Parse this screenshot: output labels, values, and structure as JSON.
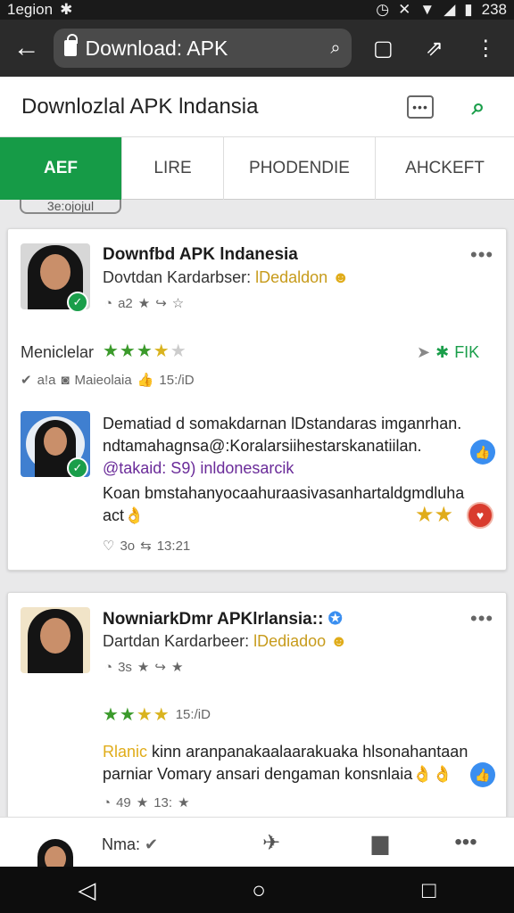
{
  "status": {
    "carrier": "1egion",
    "time": "238"
  },
  "browser": {
    "url": "Download: APK"
  },
  "header": {
    "title": "Downlozlal APK lndansia"
  },
  "tabs": [
    "AEF",
    "LIRE",
    "PHODENDIE",
    "AHCKEFT"
  ],
  "filter_chip": "3e:ojojul",
  "posts": [
    {
      "name": "Downfbd APK lndanesia",
      "subtitle_prefix": "Dovtdan Kardarbser:",
      "subtitle_highlight": "lDedaldon",
      "meta_count": "a2",
      "label": "Meniclelar",
      "action_text": "FIK",
      "stat_a": "a!a",
      "stat_b": "Maieolaia",
      "stat_time": "15:/iD",
      "reply_line1": "Dematiad d somakdarnan lDstandaras imganrhan.",
      "reply_line2": "ndtamahagnsa@:Koralarsiihestarskanatiilan.",
      "reply_link": "@takaid: S9) inldonesarcik",
      "reply_line3": "Koan bmstahanyocaahuraasivasanhartaldgmdluha",
      "reply_line4": "act",
      "reply_likes": "3o",
      "reply_time": "13:21"
    },
    {
      "name": "NowniarkDmr APKlrlansia::",
      "subtitle_prefix": "Dartdan Kardarbeer:",
      "subtitle_highlight": "lDediadoo",
      "meta_count": "3s",
      "rating_time": "15:/iD",
      "body_prefix": "Rlanic",
      "body_line1": "kinn aranpanakaalaarakuaka hlsonahantaan",
      "body_line2": "parniar Vomary ansari dengaman konsnlaia",
      "foot_count": "49",
      "foot_time": "13:"
    }
  ],
  "bottom": {
    "name": "Nma:"
  },
  "colors": {
    "accent": "#169b47",
    "star": "#3b9a2b",
    "gold": "#e0ac1a"
  }
}
